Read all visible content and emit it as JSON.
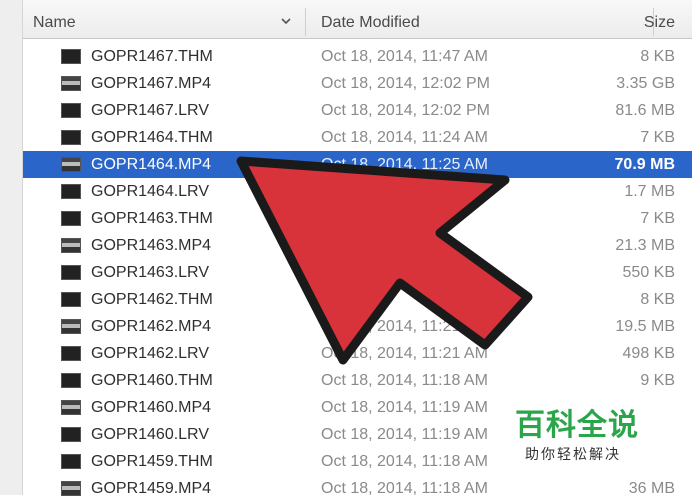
{
  "columns": {
    "name": "Name",
    "date_modified": "Date Modified",
    "size": "Size"
  },
  "selected_index": 4,
  "files": [
    {
      "name": "GOPR1467.THM",
      "date": "Oct 18, 2014, 11:47 AM",
      "size": "8 KB",
      "type": "thm"
    },
    {
      "name": "GOPR1467.MP4",
      "date": "Oct 18, 2014, 12:02 PM",
      "size": "3.35 GB",
      "type": "video"
    },
    {
      "name": "GOPR1467.LRV",
      "date": "Oct 18, 2014, 12:02 PM",
      "size": "81.6 MB",
      "type": "lrv"
    },
    {
      "name": "GOPR1464.THM",
      "date": "Oct 18, 2014, 11:24 AM",
      "size": "7 KB",
      "type": "thm"
    },
    {
      "name": "GOPR1464.MP4",
      "date": "Oct 18, 2014, 11:25 AM",
      "size": "70.9 MB",
      "type": "video"
    },
    {
      "name": "GOPR1464.LRV",
      "date": "",
      "size": "1.7 MB",
      "type": "lrv"
    },
    {
      "name": "GOPR1463.THM",
      "date": "",
      "size": "7 KB",
      "type": "thm"
    },
    {
      "name": "GOPR1463.MP4",
      "date": "",
      "size": "21.3 MB",
      "type": "video"
    },
    {
      "name": "GOPR1463.LRV",
      "date": "",
      "size": "550 KB",
      "type": "lrv"
    },
    {
      "name": "GOPR1462.THM",
      "date": "",
      "size": "8 KB",
      "type": "thm"
    },
    {
      "name": "GOPR1462.MP4",
      "date": "Oct 18, 2014, 11:21 AM",
      "size": "19.5 MB",
      "type": "video"
    },
    {
      "name": "GOPR1462.LRV",
      "date": "Oct 18, 2014, 11:21 AM",
      "size": "498 KB",
      "type": "lrv"
    },
    {
      "name": "GOPR1460.THM",
      "date": "Oct 18, 2014, 11:18 AM",
      "size": "9 KB",
      "type": "thm"
    },
    {
      "name": "GOPR1460.MP4",
      "date": "Oct 18, 2014, 11:19 AM",
      "size": "",
      "type": "video"
    },
    {
      "name": "GOPR1460.LRV",
      "date": "Oct 18, 2014, 11:19 AM",
      "size": "",
      "type": "lrv"
    },
    {
      "name": "GOPR1459.THM",
      "date": "Oct 18, 2014, 11:18 AM",
      "size": "",
      "type": "thm"
    },
    {
      "name": "GOPR1459.MP4",
      "date": "Oct 18, 2014, 11:18 AM",
      "size": "36 MB",
      "type": "video"
    }
  ],
  "overlay": {
    "arrow_color": "#d8323a",
    "watermark_title": "百科全说",
    "watermark_subtitle": "助你轻松解决"
  }
}
